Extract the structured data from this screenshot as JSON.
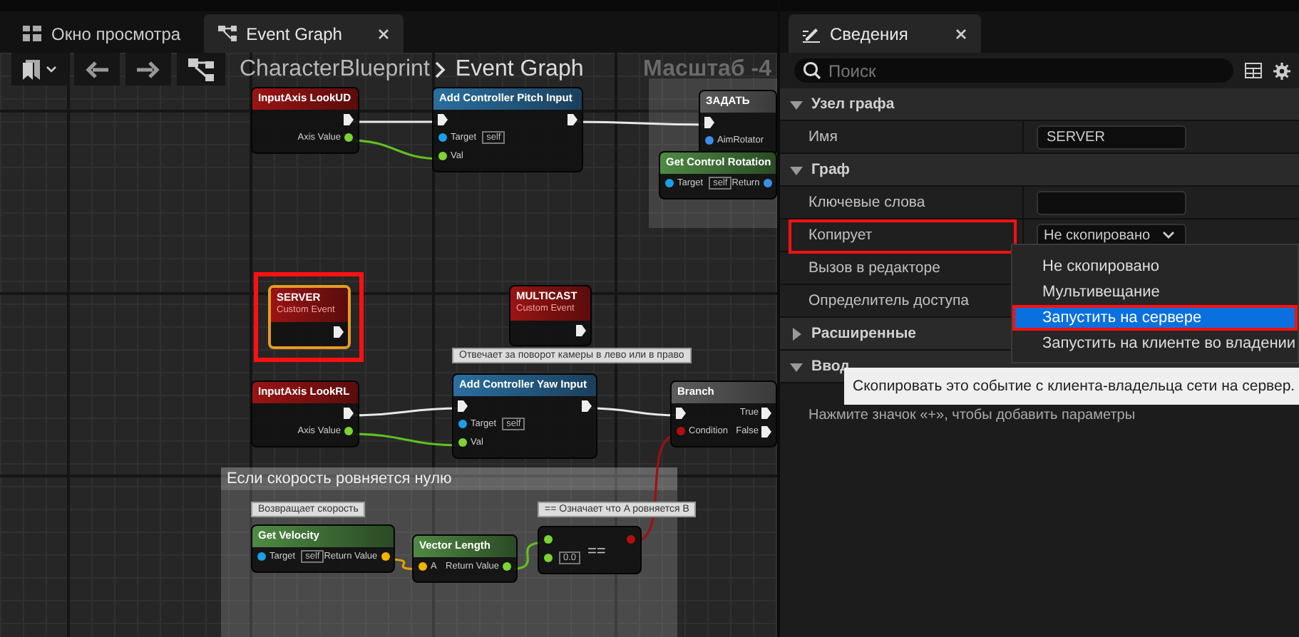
{
  "editor_tabs": [
    {
      "label": "Окно просмотра",
      "selected": false,
      "closable": false
    },
    {
      "label": "Event Graph",
      "selected": true,
      "closable": true
    }
  ],
  "breadcrumb": {
    "path": "CharacterBlueprint",
    "current": "Event Graph"
  },
  "zoom_label": "Масштаб -4",
  "graph": {
    "nodes": [
      {
        "title": "InputAxis LookUD",
        "kind": "event",
        "selected": false,
        "highlighted": false,
        "outputs": [
          {
            "kind": "exec"
          },
          {
            "label": "Axis Value",
            "kind": "float"
          }
        ]
      },
      {
        "title": "Add Controller Pitch Input",
        "kind": "call",
        "selected": false,
        "highlighted": false,
        "inputs": [
          {
            "kind": "exec"
          },
          {
            "label": "Target",
            "kind": "object",
            "value": "self"
          },
          {
            "label": "Val",
            "kind": "float"
          }
        ],
        "outputs": [
          {
            "kind": "exec"
          }
        ]
      },
      {
        "title": "ЗАДАТЬ",
        "kind": "setter",
        "selected": false,
        "highlighted": false,
        "inputs": [
          {
            "kind": "exec"
          },
          {
            "label": "AimRotator",
            "kind": "struct"
          }
        ]
      },
      {
        "title": "Get Control Rotation",
        "kind": "pure",
        "selected": false,
        "highlighted": false,
        "inputs": [
          {
            "label": "Target",
            "kind": "object",
            "value": "self"
          }
        ],
        "outputs": [
          {
            "label": "Return",
            "kind": "struct"
          }
        ]
      },
      {
        "title": "SERVER",
        "subtitle": "Custom Event",
        "kind": "event",
        "selected": true,
        "highlighted": true,
        "outputs": [
          {
            "kind": "exec"
          }
        ]
      },
      {
        "title": "MULTICAST",
        "subtitle": "Custom Event",
        "kind": "event",
        "selected": false,
        "highlighted": false,
        "outputs": [
          {
            "kind": "exec"
          }
        ]
      },
      {
        "title": "InputAxis LookRL",
        "kind": "event",
        "selected": false,
        "highlighted": false,
        "outputs": [
          {
            "kind": "exec"
          },
          {
            "label": "Axis Value",
            "kind": "float"
          }
        ]
      },
      {
        "title": "Add Controller Yaw Input",
        "kind": "call",
        "selected": false,
        "highlighted": false,
        "inputs": [
          {
            "kind": "exec"
          },
          {
            "label": "Target",
            "kind": "object",
            "value": "self"
          },
          {
            "label": "Val",
            "kind": "float"
          }
        ],
        "outputs": [
          {
            "kind": "exec"
          }
        ]
      },
      {
        "title": "Branch",
        "kind": "macro",
        "selected": false,
        "highlighted": false,
        "inputs": [
          {
            "kind": "exec"
          },
          {
            "label": "Condition",
            "kind": "bool"
          }
        ],
        "outputs": [
          {
            "label": "True",
            "kind": "exec"
          },
          {
            "label": "False",
            "kind": "exec"
          }
        ]
      },
      {
        "title": "Get Velocity",
        "kind": "pure",
        "selected": false,
        "highlighted": false,
        "inputs": [
          {
            "label": "Target",
            "kind": "object",
            "value": "self"
          }
        ],
        "outputs": [
          {
            "label": "Return Value",
            "kind": "vector"
          }
        ]
      },
      {
        "title": "Vector Length",
        "kind": "pure",
        "selected": false,
        "highlighted": false,
        "inputs": [
          {
            "label": "A",
            "kind": "vector"
          }
        ],
        "outputs": [
          {
            "label": "Return Value",
            "kind": "float"
          }
        ]
      },
      {
        "symbol": "==",
        "kind": "operator",
        "selected": false,
        "highlighted": false,
        "inputs": [
          {
            "kind": "float"
          },
          {
            "kind": "float",
            "value": "0.0"
          }
        ],
        "outputs": [
          {
            "kind": "bool"
          }
        ]
      }
    ],
    "comments": [
      "Отвечает за поворот камеры в лево или в право",
      "Возвращает скорость",
      "== Означает что A ровняется B"
    ],
    "groups": [
      {
        "title": "Если скорость ровняется нулю"
      }
    ]
  },
  "details": {
    "tab": {
      "label": "Сведения",
      "closable": true
    },
    "search": {
      "placeholder": "Поиск"
    },
    "sections": [
      {
        "title": "Узел графа",
        "expanded": true,
        "rows": [
          {
            "label": "Имя",
            "kind": "text",
            "value": "SERVER",
            "highlighted": false
          }
        ]
      },
      {
        "title": "Граф",
        "expanded": true,
        "rows": [
          {
            "label": "Ключевые слова",
            "kind": "text",
            "highlighted": false
          },
          {
            "label": "Копирует",
            "kind": "dropdown",
            "value": "Не скопировано",
            "highlighted": true
          },
          {
            "label": "Вызов в редакторе",
            "kind": "plain",
            "highlighted": false
          },
          {
            "label": "Определитель доступа",
            "kind": "plain",
            "highlighted": false
          }
        ]
      },
      {
        "title": "Расширенные",
        "expanded": false
      },
      {
        "title": "Ввод",
        "expanded": true,
        "hint": "Нажмите значок «+», чтобы добавить параметры"
      }
    ]
  },
  "dropdown_menu": {
    "options": [
      {
        "label": "Не скопировано",
        "selected": false,
        "highlighted": false
      },
      {
        "label": "Мультивещание",
        "selected": false,
        "highlighted": false
      },
      {
        "label": "Запустить на сервере",
        "selected": true,
        "highlighted": true
      },
      {
        "label": "Запустить на клиенте во владении",
        "selected": false,
        "highlighted": false
      }
    ]
  },
  "tooltip": "Скопировать это событие с клиента-владельца сети на сервер."
}
